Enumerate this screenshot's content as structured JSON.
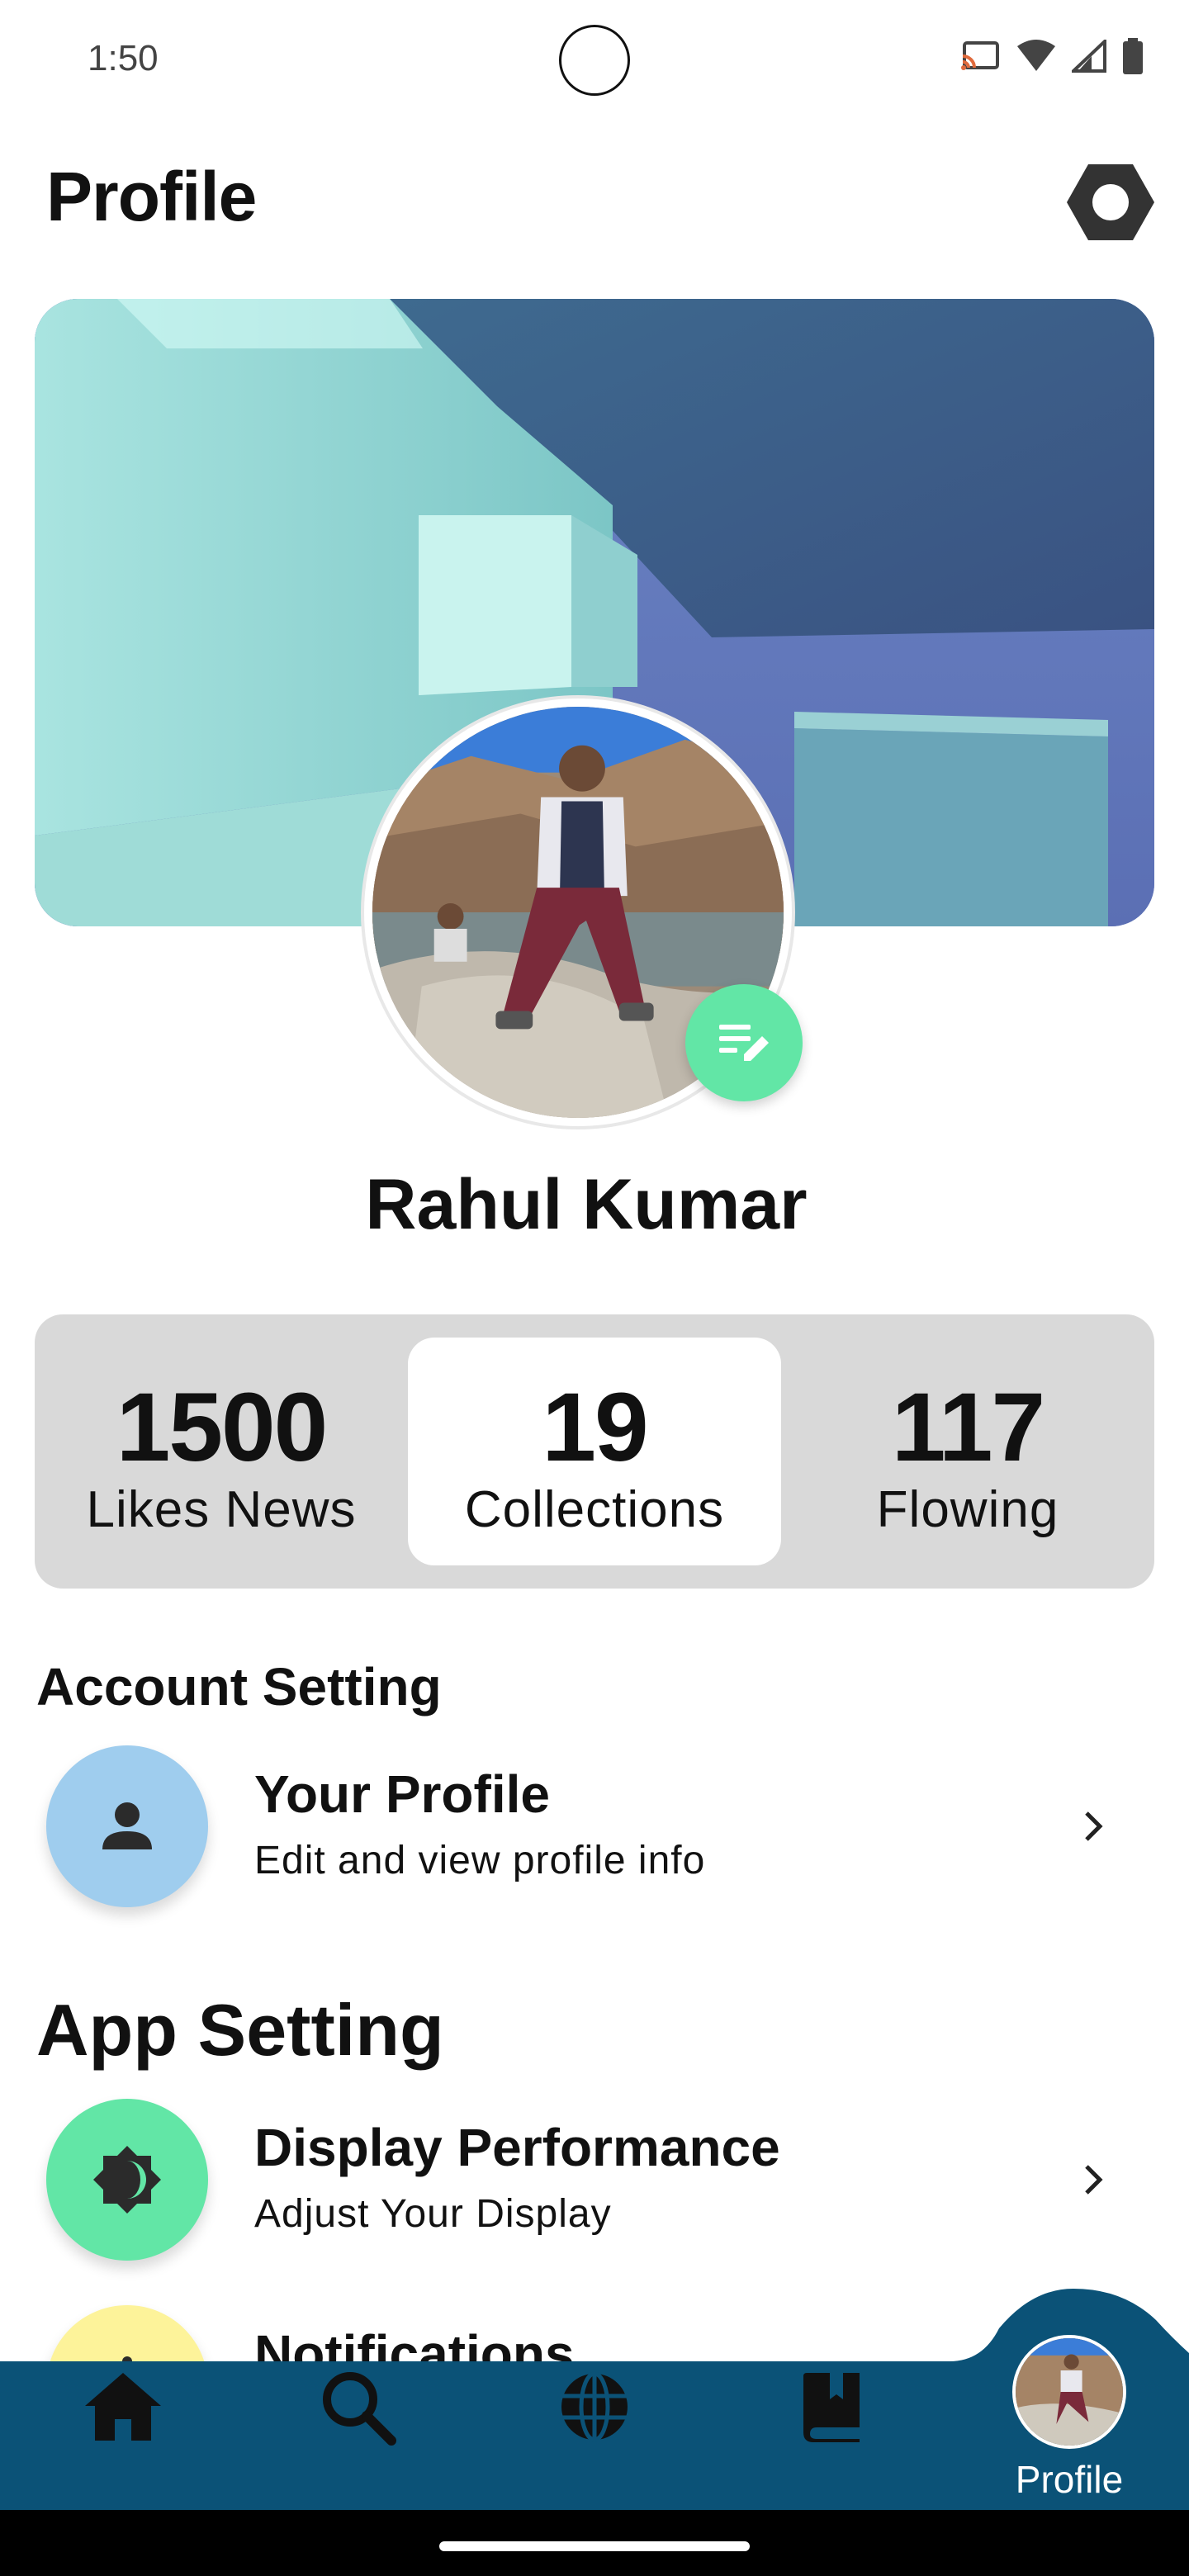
{
  "status_bar": {
    "time": "1:50",
    "icons": [
      "cast-icon",
      "wifi-icon",
      "signal-icon",
      "battery-icon"
    ]
  },
  "header": {
    "title": "Profile",
    "settings_icon": "settings-hex-icon"
  },
  "profile": {
    "name": "Rahul Kumar",
    "edit_icon": "edit-note-icon",
    "edit_color": "#62e6a6"
  },
  "stats": [
    {
      "value": "1500",
      "label": "Likes News",
      "active": false
    },
    {
      "value": "19",
      "label": "Collections",
      "active": true
    },
    {
      "value": "117",
      "label": "Flowing",
      "active": false
    }
  ],
  "sections": {
    "account": {
      "title": "Account Setting",
      "items": [
        {
          "title": "Your Profile",
          "subtitle": "Edit and view profile info",
          "icon": "person-icon",
          "color": "#9fcdee"
        }
      ]
    },
    "app": {
      "title": "App Setting",
      "items": [
        {
          "title": "Display Performance",
          "subtitle": "Adjust Your Display",
          "icon": "brightness-icon",
          "color": "#62e6a6"
        },
        {
          "title": "Notifications",
          "subtitle": "",
          "icon": "notifications-icon",
          "color": "#fdf39a"
        }
      ]
    }
  },
  "bottom_nav": {
    "background": "#0b5277",
    "items": [
      {
        "icon": "home-icon"
      },
      {
        "icon": "search-icon"
      },
      {
        "icon": "globe-icon"
      },
      {
        "icon": "bookmark-book-icon"
      }
    ],
    "active_label": "Profile"
  }
}
